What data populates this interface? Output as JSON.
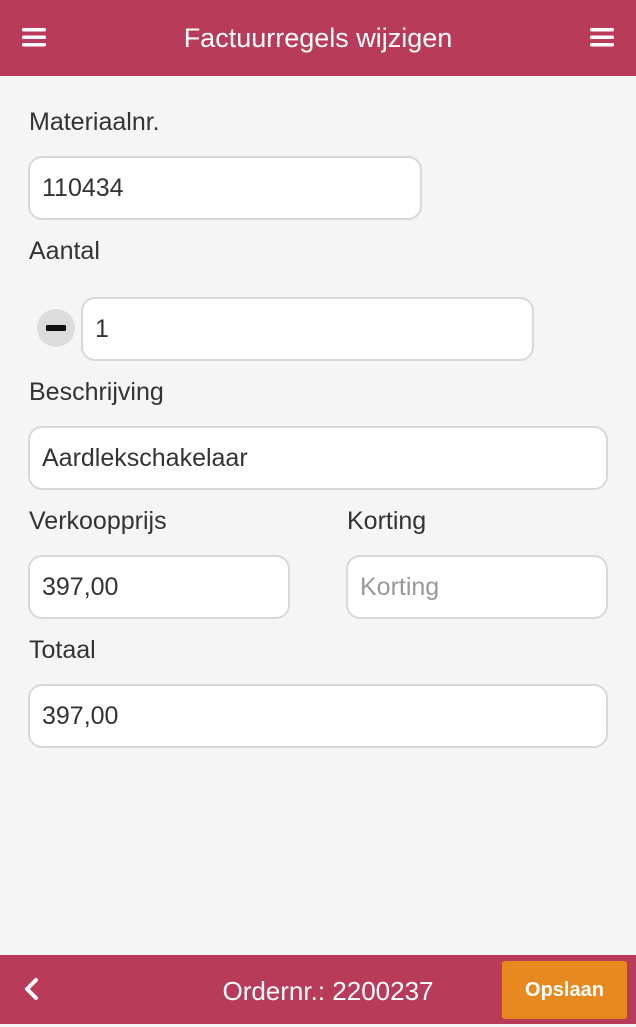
{
  "header": {
    "title": "Factuurregels wijzigen",
    "left_icon": "menu-icon",
    "right_icon": "menu-icon"
  },
  "form": {
    "material": {
      "label": "Materiaalnr.",
      "value": "110434"
    },
    "quantity": {
      "label": "Aantal",
      "value": "1",
      "decrement_icon": "minus-icon"
    },
    "description": {
      "label": "Beschrijving",
      "value": "Aardlekschakelaar"
    },
    "price": {
      "label": "Verkoopprijs",
      "value": "397,00"
    },
    "discount": {
      "label": "Korting",
      "value": "",
      "placeholder": "Korting"
    },
    "total": {
      "label": "Totaal",
      "value": "397,00"
    }
  },
  "footer": {
    "back_icon": "chevron-left-icon",
    "order_text": "Ordernr.: 2200237",
    "save_label": "Opslaan"
  },
  "colors": {
    "brand": "#b93b5a",
    "save_button": "#e8891f",
    "background": "#f5f5f5"
  }
}
